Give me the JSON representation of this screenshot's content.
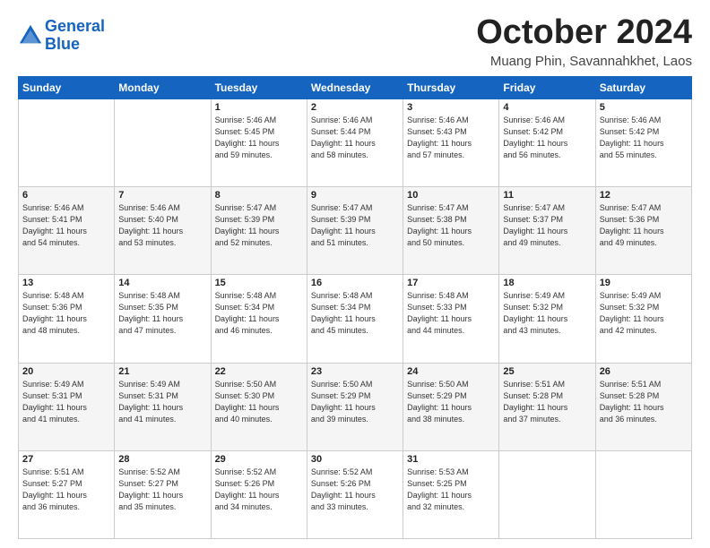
{
  "header": {
    "logo_line1": "General",
    "logo_line2": "Blue",
    "month": "October 2024",
    "location": "Muang Phin, Savannahkhet, Laos"
  },
  "weekdays": [
    "Sunday",
    "Monday",
    "Tuesday",
    "Wednesday",
    "Thursday",
    "Friday",
    "Saturday"
  ],
  "weeks": [
    [
      {
        "day": "",
        "info": ""
      },
      {
        "day": "",
        "info": ""
      },
      {
        "day": "1",
        "info": "Sunrise: 5:46 AM\nSunset: 5:45 PM\nDaylight: 11 hours\nand 59 minutes."
      },
      {
        "day": "2",
        "info": "Sunrise: 5:46 AM\nSunset: 5:44 PM\nDaylight: 11 hours\nand 58 minutes."
      },
      {
        "day": "3",
        "info": "Sunrise: 5:46 AM\nSunset: 5:43 PM\nDaylight: 11 hours\nand 57 minutes."
      },
      {
        "day": "4",
        "info": "Sunrise: 5:46 AM\nSunset: 5:42 PM\nDaylight: 11 hours\nand 56 minutes."
      },
      {
        "day": "5",
        "info": "Sunrise: 5:46 AM\nSunset: 5:42 PM\nDaylight: 11 hours\nand 55 minutes."
      }
    ],
    [
      {
        "day": "6",
        "info": "Sunrise: 5:46 AM\nSunset: 5:41 PM\nDaylight: 11 hours\nand 54 minutes."
      },
      {
        "day": "7",
        "info": "Sunrise: 5:46 AM\nSunset: 5:40 PM\nDaylight: 11 hours\nand 53 minutes."
      },
      {
        "day": "8",
        "info": "Sunrise: 5:47 AM\nSunset: 5:39 PM\nDaylight: 11 hours\nand 52 minutes."
      },
      {
        "day": "9",
        "info": "Sunrise: 5:47 AM\nSunset: 5:39 PM\nDaylight: 11 hours\nand 51 minutes."
      },
      {
        "day": "10",
        "info": "Sunrise: 5:47 AM\nSunset: 5:38 PM\nDaylight: 11 hours\nand 50 minutes."
      },
      {
        "day": "11",
        "info": "Sunrise: 5:47 AM\nSunset: 5:37 PM\nDaylight: 11 hours\nand 49 minutes."
      },
      {
        "day": "12",
        "info": "Sunrise: 5:47 AM\nSunset: 5:36 PM\nDaylight: 11 hours\nand 49 minutes."
      }
    ],
    [
      {
        "day": "13",
        "info": "Sunrise: 5:48 AM\nSunset: 5:36 PM\nDaylight: 11 hours\nand 48 minutes."
      },
      {
        "day": "14",
        "info": "Sunrise: 5:48 AM\nSunset: 5:35 PM\nDaylight: 11 hours\nand 47 minutes."
      },
      {
        "day": "15",
        "info": "Sunrise: 5:48 AM\nSunset: 5:34 PM\nDaylight: 11 hours\nand 46 minutes."
      },
      {
        "day": "16",
        "info": "Sunrise: 5:48 AM\nSunset: 5:34 PM\nDaylight: 11 hours\nand 45 minutes."
      },
      {
        "day": "17",
        "info": "Sunrise: 5:48 AM\nSunset: 5:33 PM\nDaylight: 11 hours\nand 44 minutes."
      },
      {
        "day": "18",
        "info": "Sunrise: 5:49 AM\nSunset: 5:32 PM\nDaylight: 11 hours\nand 43 minutes."
      },
      {
        "day": "19",
        "info": "Sunrise: 5:49 AM\nSunset: 5:32 PM\nDaylight: 11 hours\nand 42 minutes."
      }
    ],
    [
      {
        "day": "20",
        "info": "Sunrise: 5:49 AM\nSunset: 5:31 PM\nDaylight: 11 hours\nand 41 minutes."
      },
      {
        "day": "21",
        "info": "Sunrise: 5:49 AM\nSunset: 5:31 PM\nDaylight: 11 hours\nand 41 minutes."
      },
      {
        "day": "22",
        "info": "Sunrise: 5:50 AM\nSunset: 5:30 PM\nDaylight: 11 hours\nand 40 minutes."
      },
      {
        "day": "23",
        "info": "Sunrise: 5:50 AM\nSunset: 5:29 PM\nDaylight: 11 hours\nand 39 minutes."
      },
      {
        "day": "24",
        "info": "Sunrise: 5:50 AM\nSunset: 5:29 PM\nDaylight: 11 hours\nand 38 minutes."
      },
      {
        "day": "25",
        "info": "Sunrise: 5:51 AM\nSunset: 5:28 PM\nDaylight: 11 hours\nand 37 minutes."
      },
      {
        "day": "26",
        "info": "Sunrise: 5:51 AM\nSunset: 5:28 PM\nDaylight: 11 hours\nand 36 minutes."
      }
    ],
    [
      {
        "day": "27",
        "info": "Sunrise: 5:51 AM\nSunset: 5:27 PM\nDaylight: 11 hours\nand 36 minutes."
      },
      {
        "day": "28",
        "info": "Sunrise: 5:52 AM\nSunset: 5:27 PM\nDaylight: 11 hours\nand 35 minutes."
      },
      {
        "day": "29",
        "info": "Sunrise: 5:52 AM\nSunset: 5:26 PM\nDaylight: 11 hours\nand 34 minutes."
      },
      {
        "day": "30",
        "info": "Sunrise: 5:52 AM\nSunset: 5:26 PM\nDaylight: 11 hours\nand 33 minutes."
      },
      {
        "day": "31",
        "info": "Sunrise: 5:53 AM\nSunset: 5:25 PM\nDaylight: 11 hours\nand 32 minutes."
      },
      {
        "day": "",
        "info": ""
      },
      {
        "day": "",
        "info": ""
      }
    ]
  ]
}
